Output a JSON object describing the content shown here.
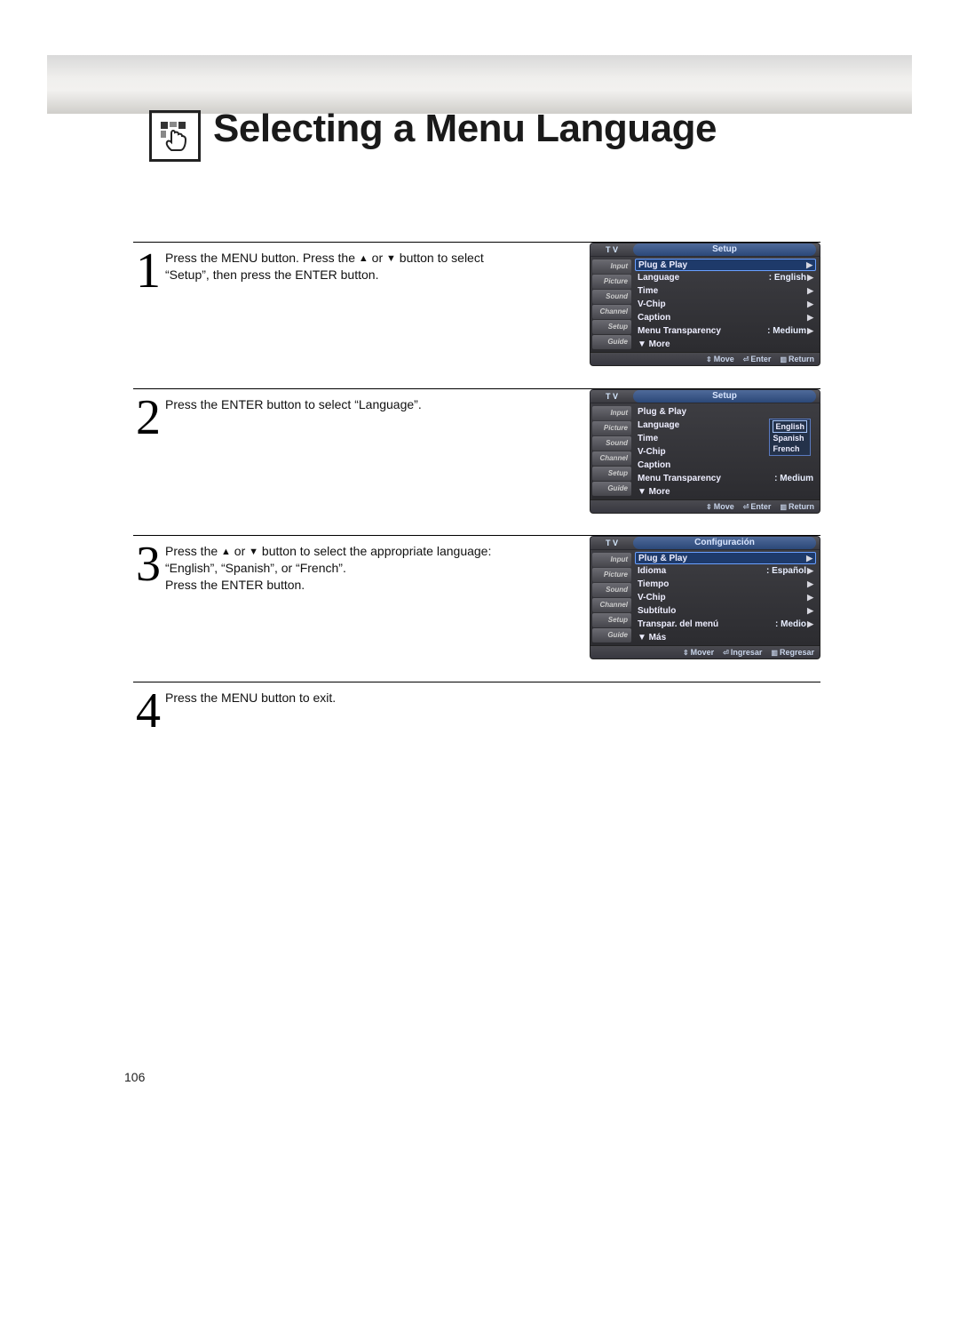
{
  "title": "Selecting a Menu Language",
  "page_number": "106",
  "steps": {
    "s1": {
      "num": "1",
      "text_a": "Press the MENU button. Press the ",
      "text_b": " or ",
      "text_c": " button to select “Setup”, then press the ENTER button."
    },
    "s2": {
      "num": "2",
      "text": "Press the ENTER button to select “Language”."
    },
    "s3": {
      "num": "3",
      "text_a": "Press the ",
      "text_b": " or ",
      "text_c": " button to select the appropriate language: “English”, “Spanish”, or “French”.",
      "text_d": "Press the ENTER button."
    },
    "s4": {
      "num": "4",
      "text": "Press the MENU button to exit."
    }
  },
  "menu_common": {
    "tv": "T V",
    "side": [
      "Input",
      "Picture",
      "Sound",
      "Channel",
      "Setup",
      "Guide"
    ]
  },
  "menu1": {
    "tab": "Setup",
    "rows": {
      "r0": {
        "lbl": "Plug & Play"
      },
      "r1": {
        "lbl": "Language",
        "val": ": English"
      },
      "r2": {
        "lbl": "Time"
      },
      "r3": {
        "lbl": "V-Chip"
      },
      "r4": {
        "lbl": "Caption"
      },
      "r5": {
        "lbl": "Menu Transparency",
        "val": ": Medium"
      },
      "r6": {
        "lbl": "▼ More"
      }
    },
    "footer": {
      "move": "Move",
      "enter": "Enter",
      "return": "Return"
    }
  },
  "menu2": {
    "tab": "Setup",
    "rows": {
      "r0": {
        "lbl": "Plug & Play"
      },
      "r1": {
        "lbl": "Language",
        "opts": {
          "o0": "English",
          "o1": "Spanish",
          "o2": "French"
        }
      },
      "r2": {
        "lbl": "Time"
      },
      "r3": {
        "lbl": "V-Chip"
      },
      "r4": {
        "lbl": "Caption"
      },
      "r5": {
        "lbl": "Menu Transparency",
        "val": ": Medium"
      },
      "r6": {
        "lbl": "▼ More"
      }
    },
    "footer": {
      "move": "Move",
      "enter": "Enter",
      "return": "Return"
    }
  },
  "menu3": {
    "tab": "Configuración",
    "rows": {
      "r0": {
        "lbl": "Plug & Play"
      },
      "r1": {
        "lbl": "Idioma",
        "val": ": Español"
      },
      "r2": {
        "lbl": "Tiempo"
      },
      "r3": {
        "lbl": "V-Chip"
      },
      "r4": {
        "lbl": "Subtítulo"
      },
      "r5": {
        "lbl": "Transpar. del menú",
        "val": ": Medio"
      },
      "r6": {
        "lbl": "▼ Más"
      }
    },
    "footer": {
      "move": "Mover",
      "enter": "Ingresar",
      "return": "Regresar"
    }
  }
}
